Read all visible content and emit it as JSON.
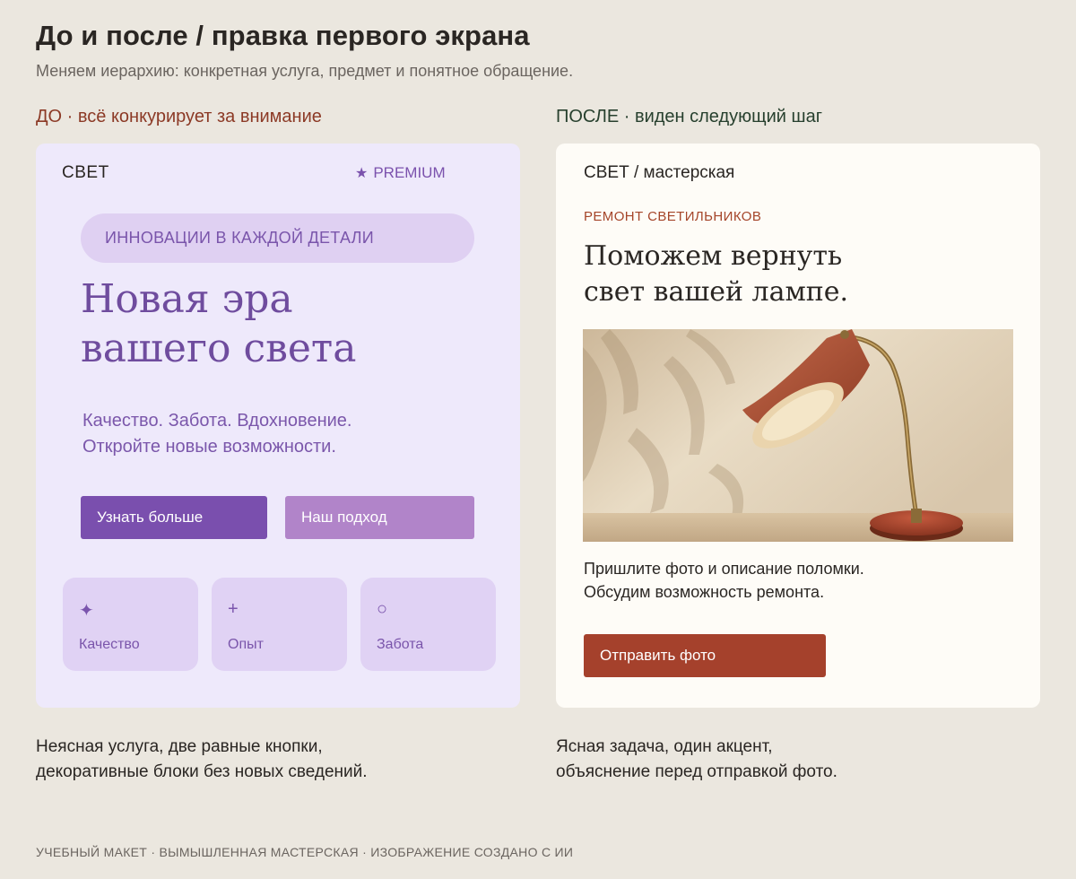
{
  "header": {
    "title": "До и после / правка первого экрана",
    "subtitle": "Меняем иерархию: конкретная услуга, предмет и понятное обращение."
  },
  "before": {
    "label": "ДО · всё конкурирует за внимание",
    "brand": "СВЕТ",
    "premium_label": "PREMIUM",
    "pill": "ИННОВАЦИИ В КАЖДОЙ ДЕТАЛИ",
    "headline_line1": "Новая эра",
    "headline_line2": "вашего света",
    "text_line1": "Качество. Забота. Вдохновение.",
    "text_line2": "Откройте новые возможности.",
    "button_primary": "Узнать больше",
    "button_secondary": "Наш подход",
    "cards": [
      {
        "icon": "✦",
        "icon_name": "sparkle-icon",
        "label": "Качество"
      },
      {
        "icon": "+",
        "icon_name": "plus-icon",
        "label": "Опыт"
      },
      {
        "icon": "○",
        "icon_name": "circle-icon",
        "label": "Забота"
      }
    ],
    "caption_line1": "Неясная услуга, две равные кнопки,",
    "caption_line2": "декоративные блоки без новых сведений."
  },
  "after": {
    "label": "ПОСЛЕ · виден следующий шаг",
    "brand": "СВЕТ / мастерская",
    "kicker": "РЕМОНТ СВЕТИЛЬНИКОВ",
    "headline_line1": "Поможем вернуть",
    "headline_line2": "свет вашей лампе.",
    "text_line1": "Пришлите фото и описание поломки.",
    "text_line2": "Обсудим возможность ремонта.",
    "button": "Отправить фото",
    "caption_line1": "Ясная задача, один акцент,",
    "caption_line2": "объяснение перед отправкой фото."
  },
  "footer": "УЧЕБНЫЙ МАКЕТ · ВЫМЫШЛЕННАЯ МАСТЕРСКАЯ · ИЗОБРАЖЕНИЕ СОЗДАНО С ИИ",
  "colors": {
    "background": "#ebe7df",
    "before_panel": "#eee9fb",
    "before_accent": "#7a4fae",
    "after_panel": "#fefcf7",
    "after_accent": "#a5412c"
  }
}
